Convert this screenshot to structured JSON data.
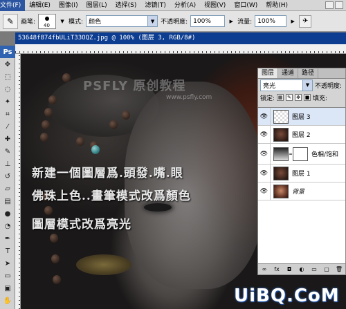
{
  "menu": {
    "items": [
      "文件(F)",
      "编辑(E)",
      "图像(I)",
      "图层(L)",
      "选择(S)",
      "滤镜(T)",
      "分析(A)",
      "视图(V)",
      "窗口(W)",
      "帮助(H)"
    ]
  },
  "options": {
    "brush_label": "画笔:",
    "brush_size": "40",
    "mode_label": "模式:",
    "mode_value": "颜色",
    "opacity_label": "不透明度:",
    "opacity_value": "100%",
    "flow_label": "流量:",
    "flow_value": "100%"
  },
  "toolbox": {
    "badge": "Ps"
  },
  "document": {
    "title": "53648f874fbULiT33OQZ.jpg @ 100% (图层 3, RGB/8#)"
  },
  "canvas": {
    "watermark_title": "PSFLY 原创教程",
    "watermark_url": "www.psfly.com",
    "instruction_line1": "新建一個圖層爲.頭發.嘴.眼",
    "instruction_line2": "佛珠上色..畫筆模式改爲顏色",
    "instruction_line3": "圖層模式改爲亮光"
  },
  "layers_panel": {
    "tabs": [
      "图层",
      "通道",
      "路径"
    ],
    "blend_mode": "亮光",
    "opacity_label": "不透明度:",
    "lock_label": "锁定:",
    "fill_label": "填充:",
    "layers": [
      {
        "name": "图层 3",
        "thumb": "transparent",
        "selected": true
      },
      {
        "name": "图层 2",
        "thumb": "dark",
        "selected": false
      },
      {
        "name": "色相/饱和",
        "thumb": "adjustment",
        "selected": false
      },
      {
        "name": "图层 1",
        "thumb": "dark",
        "selected": false
      },
      {
        "name": "背景",
        "thumb": "photo",
        "selected": false
      }
    ]
  },
  "brand": {
    "logo_text": "UiBQ.CoM"
  }
}
